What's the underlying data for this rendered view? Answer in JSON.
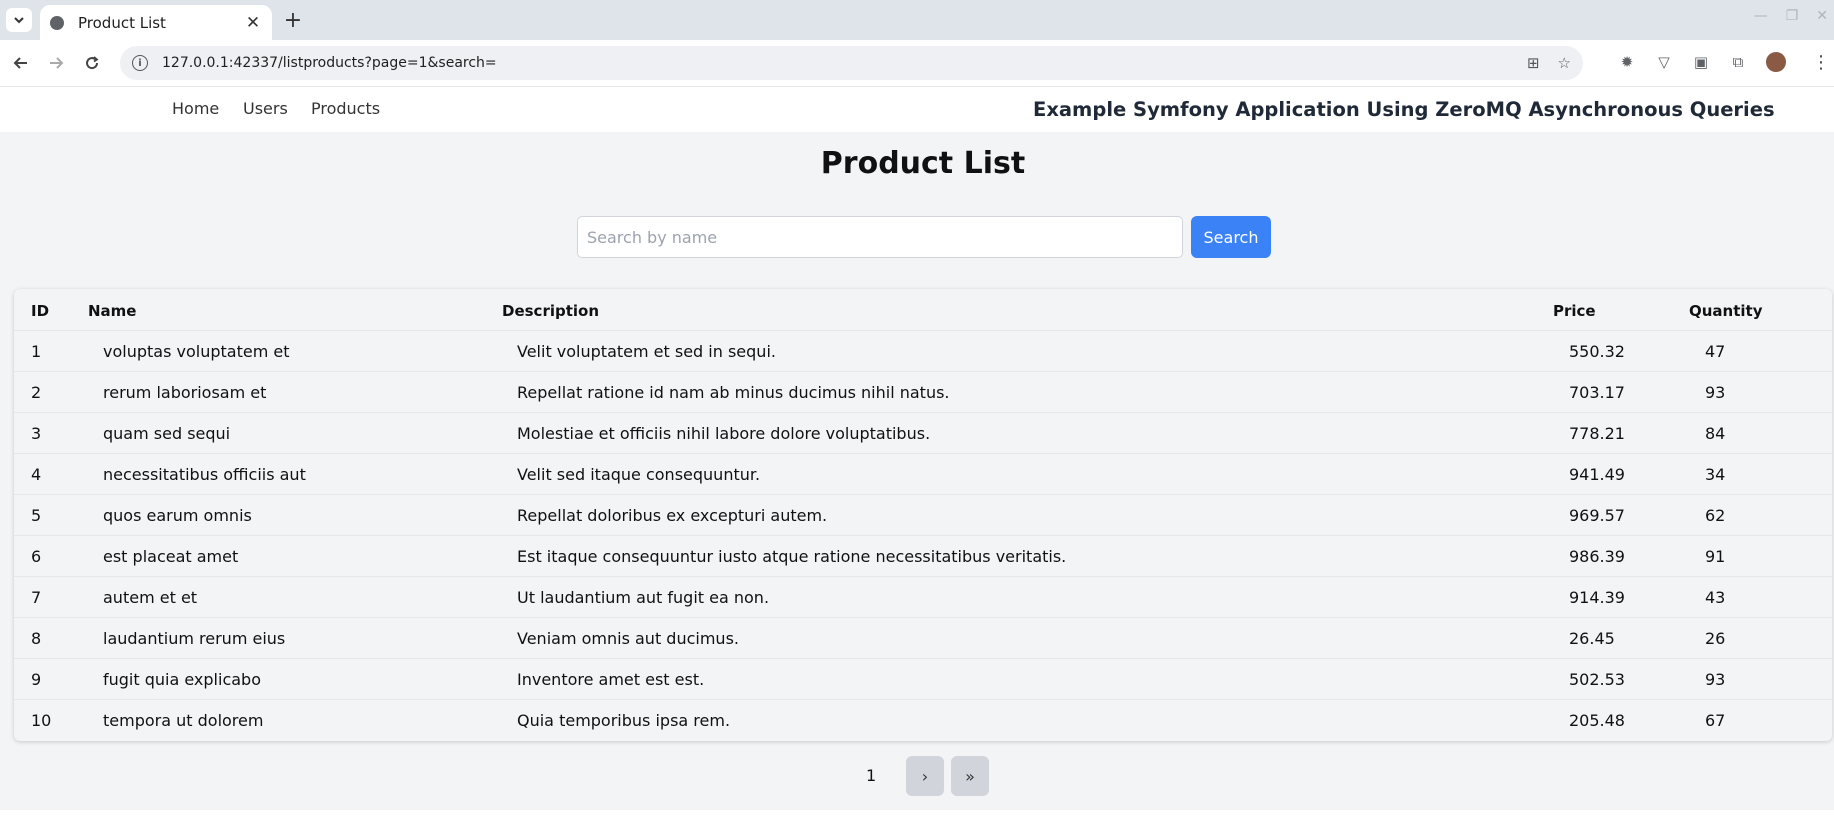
{
  "browser": {
    "tab_title": "Product List",
    "new_tab_label": "+",
    "url": "127.0.0.1:42337/listproducts?page=1&search=",
    "extension_icons": [
      "translate-icon",
      "star-icon",
      "gear-extension-icon",
      "vuejs-devtools-icon",
      "extension-box-icon",
      "puzzle-icon"
    ]
  },
  "nav": {
    "links": [
      "Home",
      "Users",
      "Products"
    ],
    "brand": "Example Symfony Application Using ZeroMQ Asynchronous Queries"
  },
  "main": {
    "title": "Product List",
    "search": {
      "placeholder": "Search by name",
      "value": "",
      "button_label": "Search"
    }
  },
  "table": {
    "columns": [
      "ID",
      "Name",
      "Description",
      "Price",
      "Quantity"
    ],
    "rows": [
      [
        "1",
        "voluptas voluptatem et",
        "Velit voluptatem et sed in sequi.",
        "550.32",
        "47"
      ],
      [
        "2",
        "rerum laboriosam et",
        "Repellat ratione id nam ab minus ducimus nihil natus.",
        "703.17",
        "93"
      ],
      [
        "3",
        "quam sed sequi",
        "Molestiae et officiis nihil labore dolore voluptatibus.",
        "778.21",
        "84"
      ],
      [
        "4",
        "necessitatibus officiis aut",
        "Velit sed itaque consequuntur.",
        "941.49",
        "34"
      ],
      [
        "5",
        "quos earum omnis",
        "Repellat doloribus ex excepturi autem.",
        "969.57",
        "62"
      ],
      [
        "6",
        "est placeat amet",
        "Est itaque consequuntur iusto atque ratione necessitatibus veritatis.",
        "986.39",
        "91"
      ],
      [
        "7",
        "autem et et",
        "Ut laudantium aut fugit ea non.",
        "914.39",
        "43"
      ],
      [
        "8",
        "laudantium rerum eius",
        "Veniam omnis aut ducimus.",
        "26.45",
        "26"
      ],
      [
        "9",
        "fugit quia explicabo",
        "Inventore amet est est.",
        "502.53",
        "93"
      ],
      [
        "10",
        "tempora ut dolorem",
        "Quia temporibus ipsa rem.",
        "205.48",
        "67"
      ]
    ]
  },
  "pagination": {
    "current": "1",
    "next_label": "›",
    "last_label": "»"
  },
  "colors": {
    "accent": "#3b82f6",
    "page_background": "#f3f4f6"
  }
}
